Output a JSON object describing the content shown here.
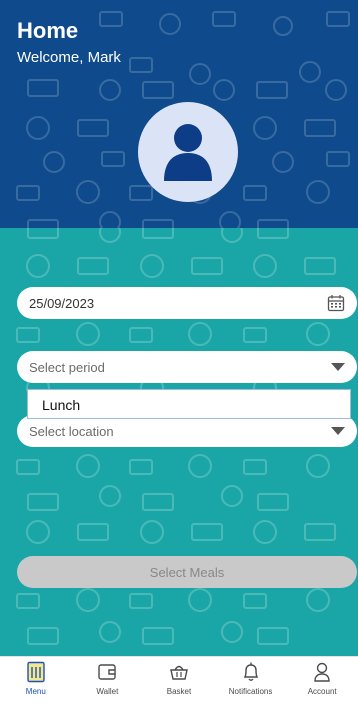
{
  "header": {
    "title": "Home",
    "welcome": "Welcome, Mark"
  },
  "form": {
    "date_value": "25/09/2023",
    "period_placeholder": "Select period",
    "period_option": "Lunch",
    "location_placeholder": "Select location",
    "select_meals_label": "Select Meals"
  },
  "nav": {
    "items": [
      {
        "label": "Menu",
        "icon": "menu-icon",
        "active": true
      },
      {
        "label": "Wallet",
        "icon": "wallet-icon"
      },
      {
        "label": "Basket",
        "icon": "basket-icon"
      },
      {
        "label": "Notifications",
        "icon": "bell-icon"
      },
      {
        "label": "Account",
        "icon": "account-icon"
      }
    ]
  },
  "colors": {
    "header_bg": "#0e4a8c",
    "body_bg": "#1aa6a6",
    "avatar_bg": "#dbe4f6",
    "avatar_fg": "#0d3d86",
    "nav_active": "#1f4fb8"
  }
}
